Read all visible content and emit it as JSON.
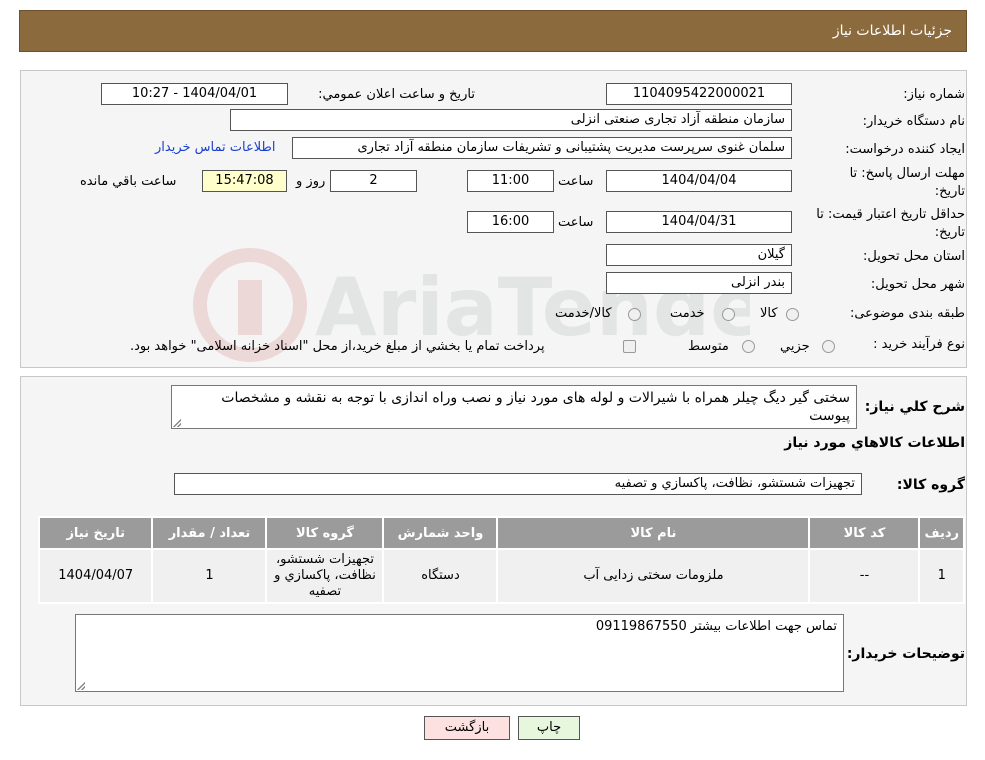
{
  "header": {
    "title": "جزئیات اطلاعات نیاز"
  },
  "form": {
    "need_number_label": "شماره نیاز:",
    "need_number": "1104095422000021",
    "announce_label": "تاریخ و ساعت اعلان عمومي:",
    "announce_value": "1404/04/01 - 10:27",
    "buyer_org_label": "نام دستگاه خريدار:",
    "buyer_org": "سازمان منطقه آزاد تجاری  صنعتی انزلی",
    "creator_label": "ايجاد كننده درخواست:",
    "creator": "سلمان غنوی سرپرست مدیریت پشتیبانی و تشریفات سازمان منطقه آزاد تجاری",
    "contact_link": "اطلاعات تماس خريدار",
    "deadline_label_1": "مهلت ارسال پاسخ: تا",
    "deadline_label_2": "تاریخ:",
    "deadline_date": "1404/04/04",
    "time_label": "ساعت",
    "deadline_time": "11:00",
    "days_value": "2",
    "days_label": "روز و",
    "remaining_time": "15:47:08",
    "remaining_label": "ساعت باقي مانده",
    "validity_label_1": "حداقل تاريخ اعتبار قيمت: تا",
    "validity_label_2": "تاریخ:",
    "validity_date": "1404/04/31",
    "validity_time": "16:00",
    "province_label": "استان محل تحويل:",
    "province": "گيلان",
    "city_label": "شهر محل تحويل:",
    "city": "بندر انزلی",
    "category_label": "طبقه بندی موضوعی:",
    "category_options": [
      "کالا",
      "خدمت",
      "کالا/خدمت"
    ],
    "process_label": "نوع فرآيند خريد :",
    "process_options": [
      "جزيي",
      "متوسط"
    ],
    "process_note": "پرداخت تمام يا بخشي از مبلغ خريد،از محل \"اسناد خزانه اسلامی\" خواهد بود."
  },
  "description": {
    "label": "شرح كلي نياز:",
    "text": "سختی گیر دیگ چیلر همراه با شیرالات و لوله های مورد نیاز و نصب وراه اندازی با توجه به نقشه و مشخصات پیوست"
  },
  "goods": {
    "section_title": "اطلاعات كالاهاي مورد نياز",
    "group_label": "گروه كالا:",
    "group_value": "تجهيزات شستشو، نظافت، پاكسازي و تصفيه"
  },
  "table": {
    "headers": [
      "رديف",
      "كد كالا",
      "نام كالا",
      "واحد شمارش",
      "گروه كالا",
      "تعداد / مقدار",
      "تاريخ نياز"
    ],
    "rows": [
      {
        "row": "1",
        "code": "--",
        "name": "ملزومات سختی زدایی آب",
        "unit": "دستگاه",
        "group": "تجهيزات شستشو، نظافت، پاكسازي و تصفيه",
        "qty": "1",
        "date": "1404/04/07"
      }
    ]
  },
  "buyer_notes": {
    "label": "توضيحات خريدار:",
    "text": "تماس جهت اطلاعات بیشتر  09119867550"
  },
  "buttons": {
    "print": "چاپ",
    "back": "بازگشت"
  },
  "colors": {
    "header": "#8b6a3e",
    "table_header": "#9b9b9b",
    "back_button": "#fde0e0",
    "print_button": "#e6f7dd"
  }
}
